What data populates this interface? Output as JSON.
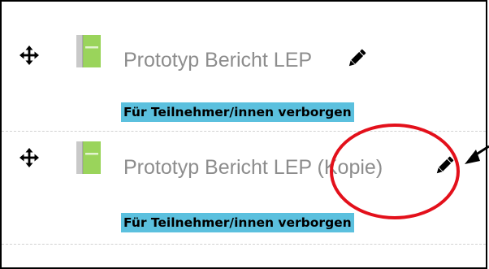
{
  "activities": [
    {
      "title": "Prototyp Bericht LEP",
      "badge": "Für Teilnehmer/innen verborgen",
      "icons": {
        "move": "move-icon",
        "book": "book-icon",
        "edit": "pencil-icon"
      }
    },
    {
      "title": "Prototyp Bericht LEP (Kopie)",
      "badge": "Für Teilnehmer/innen verborgen",
      "icons": {
        "move": "move-icon",
        "book": "book-icon",
        "edit": "pencil-icon"
      }
    }
  ],
  "colors": {
    "badge_bg": "#5bc0de",
    "title_text": "#8d8d8d",
    "book_green": "#8fce4f",
    "annotation_red": "#e3101b"
  },
  "annotation": {
    "shape": "ellipse",
    "arrow": "black-arrow"
  }
}
